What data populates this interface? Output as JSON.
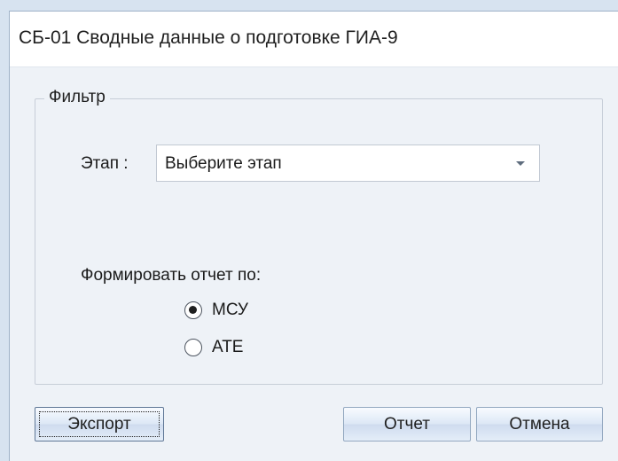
{
  "window": {
    "title": "СБ-01 Сводные данные о подготовке ГИА-9"
  },
  "filter": {
    "group_label": "Фильтр",
    "stage_label": "Этап :",
    "stage_combo": {
      "value": "Выберите этап",
      "icon": "chevron-down-icon"
    },
    "report_by_label": "Формировать отчет по:",
    "options": [
      {
        "label": "МСУ",
        "selected": true
      },
      {
        "label": "АТЕ",
        "selected": false
      }
    ]
  },
  "buttons": {
    "export": "Экспорт",
    "report": "Отчет",
    "cancel": "Отмена"
  }
}
